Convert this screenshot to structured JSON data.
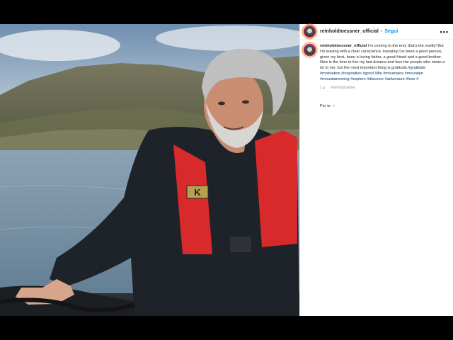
{
  "post": {
    "username": "reinholdmessner_official",
    "follow_label": "Segui",
    "separator": "•",
    "more_label": "•••",
    "caption_username": "reinholdmessner_official",
    "caption_body": "I'm coming to the end, that's the reality! But I'm leaving with a clear conscience, knowing I've been a good person, given my best, been a loving father, a good friend and a good brother. Now is the time to live my last dreams and love the people who mean a lot to me, but the most important thing is gratitude.",
    "caption_tags": "#gratitude #motivation #inspiration #good #life #mountains #mountain #mountaineering #explore #discover #adventure #love #",
    "time_ago": "1 g",
    "see_translation": "Vedi traduzione",
    "sort_label": "Per te",
    "sort_icon": "chevron-down-icon"
  },
  "photo": {
    "life_vest_badge": "K",
    "colors": {
      "sky": "#b9c9d6",
      "water": "#6f8ba0",
      "vest": "#d82a2a",
      "jacket": "#1e2229",
      "hair": "#bfbfbf"
    }
  },
  "colors": {
    "link": "#0095f6",
    "hashtag": "#00376b",
    "text": "#262626",
    "muted": "#8e8e8e"
  }
}
